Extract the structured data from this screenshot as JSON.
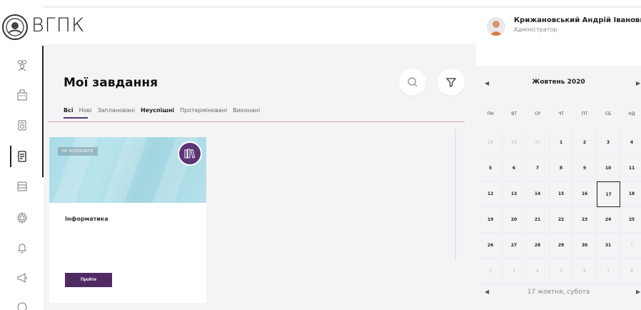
{
  "app": {
    "logo_text": "ВГПК"
  },
  "user": {
    "name": "Крижановський Андрій Іванович",
    "role": "Адміністратор"
  },
  "sidebar": {
    "items": [
      {
        "icon": "people-icon"
      },
      {
        "icon": "building-icon"
      },
      {
        "icon": "schedule-icon"
      },
      {
        "icon": "tasks-icon",
        "active": true
      },
      {
        "icon": "journal-icon"
      },
      {
        "icon": "settings-icon"
      },
      {
        "icon": "bell-icon"
      },
      {
        "icon": "megaphone-icon"
      },
      {
        "icon": "more-icon"
      }
    ]
  },
  "main": {
    "title": "Мої завдання",
    "tabs": [
      {
        "label": "Всі",
        "active": true
      },
      {
        "label": "Нові"
      },
      {
        "label": "Заплановані"
      },
      {
        "label": "Неуспішні",
        "bold": true
      },
      {
        "label": "Протерміновані"
      },
      {
        "label": "Виконані"
      }
    ],
    "card": {
      "status": "НЕ РОЗПОЧАТО",
      "title": "Інформатика",
      "button_label": "Пройти"
    }
  },
  "calendar": {
    "month_title": "Жовтень 2020",
    "weekdays": [
      "ПН",
      "ВТ",
      "СР",
      "ЧТ",
      "ПТ",
      "СБ",
      "НД"
    ],
    "weeks": [
      [
        {
          "d": "28",
          "m": true
        },
        {
          "d": "29",
          "m": true
        },
        {
          "d": "30",
          "m": true
        },
        {
          "d": "1"
        },
        {
          "d": "2"
        },
        {
          "d": "3"
        },
        {
          "d": "4"
        }
      ],
      [
        {
          "d": "5"
        },
        {
          "d": "6"
        },
        {
          "d": "7"
        },
        {
          "d": "8"
        },
        {
          "d": "9"
        },
        {
          "d": "10"
        },
        {
          "d": "11"
        }
      ],
      [
        {
          "d": "12"
        },
        {
          "d": "13"
        },
        {
          "d": "14"
        },
        {
          "d": "15"
        },
        {
          "d": "16"
        },
        {
          "d": "17",
          "sel": true
        },
        {
          "d": "18"
        }
      ],
      [
        {
          "d": "19"
        },
        {
          "d": "20"
        },
        {
          "d": "21"
        },
        {
          "d": "22"
        },
        {
          "d": "23"
        },
        {
          "d": "24"
        },
        {
          "d": "25"
        }
      ],
      [
        {
          "d": "26"
        },
        {
          "d": "27"
        },
        {
          "d": "28"
        },
        {
          "d": "29"
        },
        {
          "d": "30"
        },
        {
          "d": "31"
        },
        {
          "d": "1",
          "m": true
        }
      ],
      [
        {
          "d": "2",
          "m": true
        },
        {
          "d": "3",
          "m": true
        },
        {
          "d": "4",
          "m": true
        },
        {
          "d": "5",
          "m": true
        },
        {
          "d": "6",
          "m": true
        },
        {
          "d": "7",
          "m": true
        },
        {
          "d": "8",
          "m": true
        }
      ]
    ],
    "selected_label": "17 жовтня, субота"
  },
  "colors": {
    "accent": "#5b3575",
    "button": "#4f2a63",
    "banner": "#a9dbe6",
    "tabs_line": "#e09aa2"
  }
}
